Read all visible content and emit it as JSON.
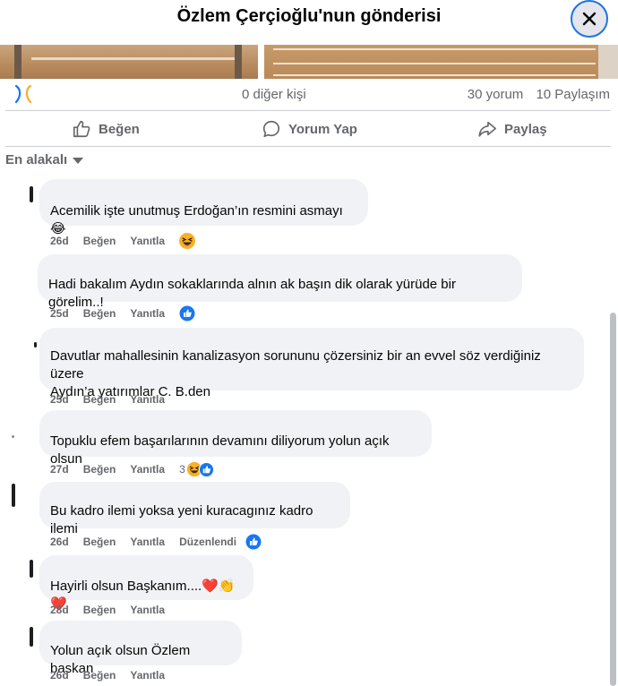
{
  "header": {
    "title": "Özlem Çerçioğlu'nun gönderisi",
    "close_icon": "close-icon"
  },
  "stats": {
    "reactors": "0 diğer kişi",
    "comments": "30 yorum",
    "shares": "10 Paylaşım"
  },
  "actions": {
    "like": "Beğen",
    "comment": "Yorum Yap",
    "share": "Paylaş"
  },
  "sort": {
    "label": "En alakalı"
  },
  "colors": {
    "blue": "#1877f2",
    "muted": "#65676b",
    "bubble": "#f0f2f5",
    "heart": "#e41e3f"
  },
  "comments": [
    {
      "text": "Acemilik işte unutmuş Erdoğan’ın resmini asmayı 😂",
      "time": "26d",
      "like": "Beğen",
      "reply": "Yanıtla",
      "reaction": "haha"
    },
    {
      "text": "Hadi bakalım Aydın sokaklarında alnın ak başın dik olarak yürüde bir görelim..!",
      "time": "25d",
      "like": "Beğen",
      "reply": "Yanıtla",
      "reaction": "like"
    },
    {
      "text_line1": "Davutlar mahallesinin kanalizasyon sorununu çözersiniz bir an evvel söz verdiğiniz üzere",
      "text_line2": "Aydın’a yatırımlar C. B.den",
      "time": "25d",
      "like": "Beğen",
      "reply": "Yanıtla"
    },
    {
      "text": "Topuklu efem başarılarının devamını diliyorum yolun açık olsun",
      "time": "27d",
      "like": "Beğen",
      "reply": "Yanıtla",
      "reaction_count": "3",
      "reaction": "haha+like"
    },
    {
      "text": "Bu kadro ilemi yoksa yeni kuracagınız kadro ilemi",
      "time": "26d",
      "like": "Beğen",
      "reply": "Yanıtla",
      "edited": "Düzenlendi",
      "reaction": "like"
    },
    {
      "text": "Hayirli olsun Başkanım....❤️👏❤️",
      "time": "28d",
      "like": "Beğen",
      "reply": "Yanıtla"
    },
    {
      "text": "Yolun açık olsun Özlem baskan",
      "time": "26d",
      "like": "Beğen",
      "reply": "Yanıtla"
    }
  ]
}
